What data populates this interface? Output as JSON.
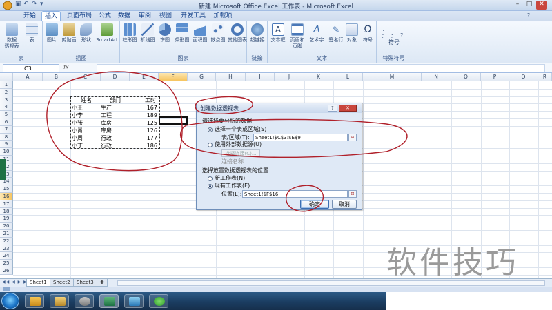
{
  "window": {
    "title": "新建 Microsoft Office Excel 工作表 - Microsoft Excel",
    "controls": [
      "–",
      "□",
      "✕"
    ]
  },
  "ribbon": {
    "tabs": [
      "开始",
      "插入",
      "页面布局",
      "公式",
      "数据",
      "审阅",
      "视图",
      "开发工具",
      "加载项"
    ],
    "active_tab": "插入",
    "groups": [
      {
        "label": "表",
        "buttons": [
          "数据\n透视表",
          "表"
        ]
      },
      {
        "label": "插图",
        "buttons": [
          "图片",
          "剪贴画",
          "形状",
          "SmartArt"
        ]
      },
      {
        "label": "图表",
        "buttons": [
          "柱形图",
          "折线图",
          "饼图",
          "条形图",
          "面积图",
          "散点图",
          "其他图表"
        ]
      },
      {
        "label": "链接",
        "buttons": [
          "超链接"
        ]
      },
      {
        "label": "文本",
        "buttons": [
          "文本框",
          "页眉和页脚",
          "艺术字",
          "签名行",
          "对象",
          "符号"
        ]
      },
      {
        "label": "特殊符号",
        "buttons": [
          "符号"
        ]
      }
    ]
  },
  "formula_bar": {
    "name_box": "C3",
    "fx": "fx",
    "value": ""
  },
  "sheet": {
    "columns": [
      "A",
      "B",
      "C",
      "D",
      "E",
      "F",
      "G",
      "H",
      "I",
      "J",
      "K",
      "L",
      "M",
      "N",
      "O",
      "P",
      "Q",
      "R"
    ],
    "rows": [
      "1",
      "2",
      "3",
      "4",
      "5",
      "6",
      "7",
      "8",
      "9",
      "10",
      "11",
      "12",
      "13",
      "14",
      "15",
      "16",
      "17",
      "18",
      "19",
      "20",
      "21",
      "22",
      "23",
      "24",
      "25",
      "26"
    ],
    "table_header": [
      "姓名",
      "部门",
      "工时"
    ],
    "table_rows": [
      [
        "小王",
        "生产",
        "167"
      ],
      [
        "小李",
        "工程",
        "189"
      ],
      [
        "小张",
        "库房",
        "125"
      ],
      [
        "小肖",
        "库房",
        "126"
      ],
      [
        "小周",
        "行政",
        "177"
      ],
      [
        "小丁",
        "行政",
        "186"
      ]
    ]
  },
  "sheet_tabs": [
    "Sheet1",
    "Sheet2",
    "Sheet3"
  ],
  "active_sheet": "Sheet1",
  "dialog": {
    "title": "创建数据透视表",
    "help": "?",
    "close": "✕",
    "section1": "请选择要分析的数据",
    "opt_table": "选择一个表或区域(S)",
    "table_label": "表/区域(T):",
    "table_value": "Sheet1!$C$3:$E$9",
    "opt_external": "使用外部数据源(U)",
    "choose_conn": "选择连接(C)...",
    "conn_name": "连接名称:",
    "section2": "选择放置数据透视表的位置",
    "opt_new": "新工作表(N)",
    "opt_existing": "现有工作表(E)",
    "location_label": "位置(L):",
    "location_value": "Sheet1!$F$16",
    "ok": "确定",
    "cancel": "取消"
  },
  "watermark": "软件技巧",
  "colors": {
    "annotation": "#b0202a",
    "ribbon_bg": "#dde8f5",
    "excel_green": "#1e7145"
  }
}
